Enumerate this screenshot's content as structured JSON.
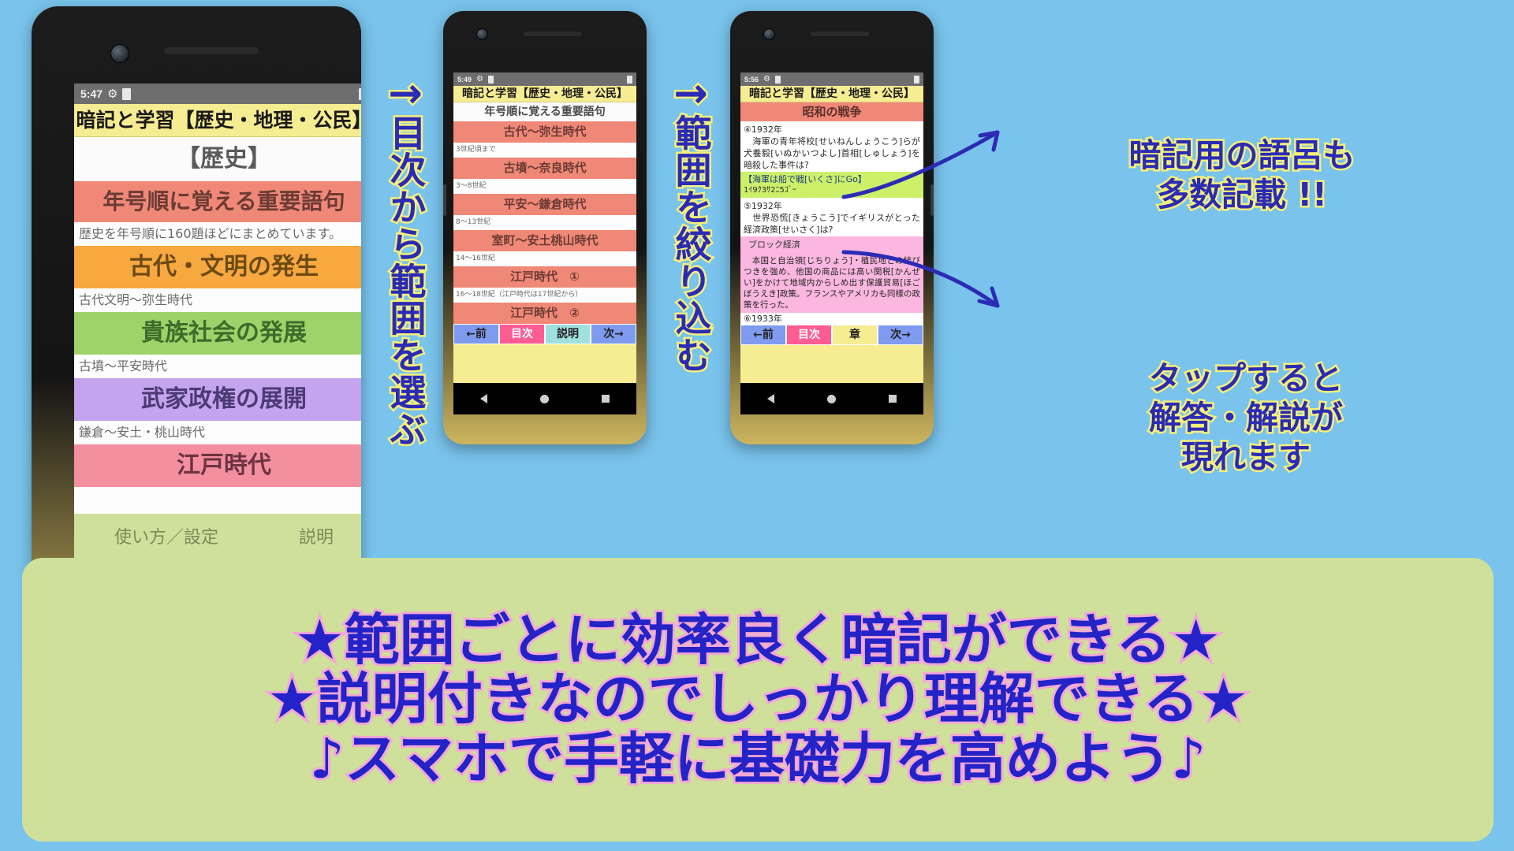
{
  "background_color": "#79c3ec",
  "phones": [
    {
      "id": "phone-1",
      "status": {
        "time": "5:47",
        "gear_icon": "gear-icon",
        "battery_icon": "battery-icon"
      },
      "app_title": "暗記と学習【歴史・地理・公民】",
      "subtitle": "【歴史】",
      "rows": [
        {
          "band": "年号順に覚える重要語句",
          "band_color": "#f08878",
          "desc": "歴史を年号順に160題ほどにまとめています。"
        },
        {
          "band": "古代・文明の発生",
          "band_color": "#f7a83f",
          "desc": "古代文明〜弥生時代"
        },
        {
          "band": "貴族社会の発展",
          "band_color": "#9ed36a",
          "desc": "古墳〜平安時代"
        },
        {
          "band": "武家政権の展開",
          "band_color": "#c4a3ef",
          "desc": "鎌倉〜安土・桃山時代"
        },
        {
          "band": "江戸時代",
          "band_color": "#f48fa0",
          "desc": ""
        }
      ],
      "footer_hint": "使い方／設定",
      "footer_hint2": "説明"
    },
    {
      "id": "phone-2",
      "status": {
        "time": "5:49",
        "gear_icon": "gear-icon",
        "battery_icon": "battery-icon"
      },
      "app_title": "暗記と学習【歴史・地理・公民】",
      "subtitle": "年号順に覚える重要語句",
      "rows": [
        {
          "band": "古代〜弥生時代",
          "band_color": "#f08878",
          "desc": "3世紀頃まで"
        },
        {
          "band": "古墳〜奈良時代",
          "band_color": "#f08878",
          "desc": "3〜8世紀"
        },
        {
          "band": "平安〜鎌倉時代",
          "band_color": "#f08878",
          "desc": "8〜13世紀"
        },
        {
          "band": "室町〜安土桃山時代",
          "band_color": "#f08878",
          "desc": "14〜16世紀"
        },
        {
          "band": "江戸時代　①",
          "band_color": "#f08878",
          "desc": "16〜18世紀（江戸時代は17世紀から）"
        },
        {
          "band": "江戸時代　②",
          "band_color": "#f08878",
          "desc": ""
        }
      ],
      "nav": [
        "←前",
        "目次",
        "説明",
        "次→"
      ]
    },
    {
      "id": "phone-3",
      "status": {
        "time": "5:56",
        "gear_icon": "gear-icon",
        "battery_icon": "battery-icon"
      },
      "app_title": "暗記と学習【歴史・地理・公民】",
      "subtitle": "昭和の戦争",
      "qa": [
        {
          "number": "④1932年",
          "question": "　海軍の青年将校[せいねんしょうこう]らが犬養毅[いぬかいつよし]首相[しゅしょう]を暗殺した事件は?",
          "answer_green": "【海軍は船で戦[いくさ]にGo】",
          "answer_kana": "1ｲ9ｸ3ｻ2ﾆ5ｺﾞｰ"
        },
        {
          "number": "⑤1932年",
          "question": "　世界恐慌[きょうこう]でイギリスがとった経済政策[せいさく]は?",
          "answer_pink_title": "ブロック経済",
          "answer_pink_body": "　本国と自治領[じちりょう]・植民地との結びつきを強め、他国の商品には高い関税[かんぜい]をかけて地域内からしめ出す保護貿易[ほごぼうえき]政策。フランスやアメリカも同様の政策を行った。"
        },
        {
          "number": "⑥1933年"
        }
      ],
      "nav": [
        "←前",
        "目次",
        "章",
        "次→"
      ]
    }
  ],
  "captions": [
    {
      "arrow": "→",
      "text": "目次から範囲を選ぶ"
    },
    {
      "arrow": "→",
      "text": "範囲を絞り込む"
    }
  ],
  "annotations": [
    {
      "id": "annot-1",
      "lines": [
        "暗記用の語呂も",
        "多数記載 !!"
      ]
    },
    {
      "id": "annot-2",
      "lines": [
        "タップすると",
        "解答・解説が",
        "現れます"
      ]
    }
  ],
  "banner": {
    "lines": [
      "★範囲ごとに効率良く暗記ができる★",
      "★説明付きなのでしっかり理解できる★",
      "♪スマホで手軽に基礎力を高めよう♪"
    ]
  }
}
